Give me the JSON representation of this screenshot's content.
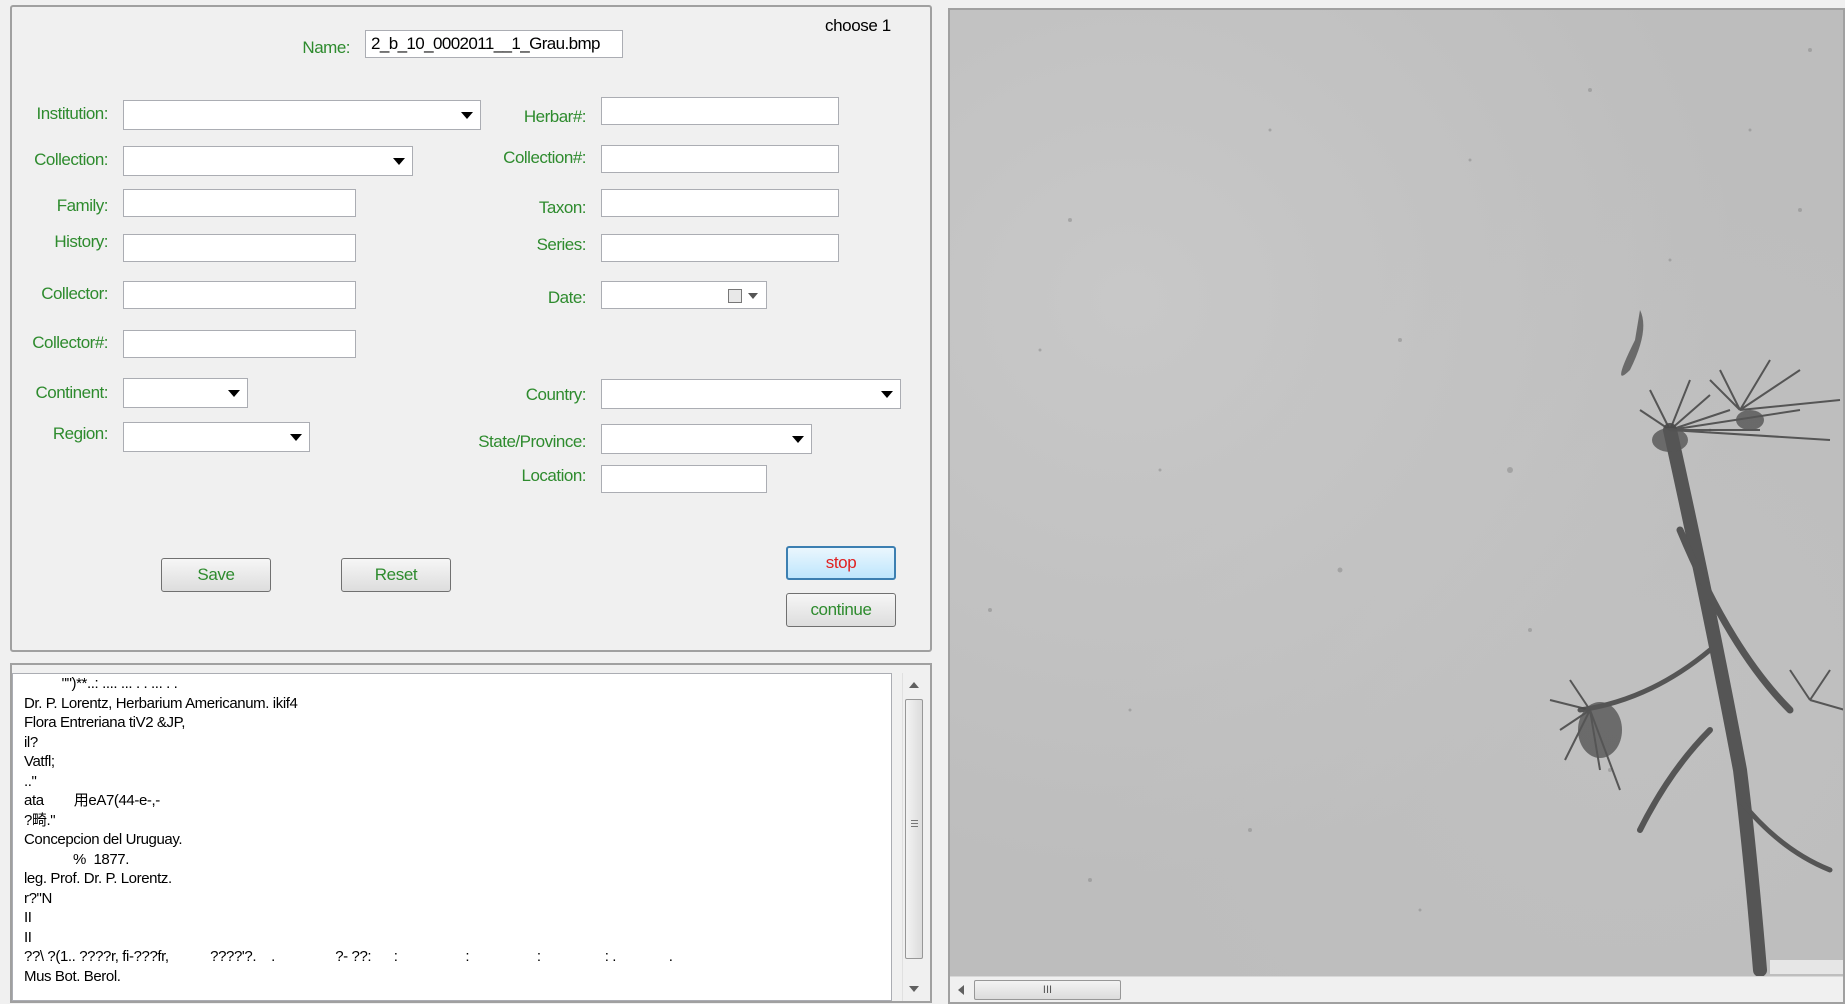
{
  "form": {
    "choose_label": "choose 1",
    "name_label": "Name:",
    "name_value": "2_b_10_0002011__1_Grau.bmp",
    "institution_label": "Institution:",
    "collection_label": "Collection:",
    "family_label": "Family:",
    "history_label": "History:",
    "collector_label": "Collector:",
    "collector_num_label": "Collector#:",
    "continent_label": "Continent:",
    "region_label": "Region:",
    "herbar_label": "Herbar#:",
    "collection_num_label": "Collection#:",
    "taxon_label": "Taxon:",
    "series_label": "Series:",
    "date_label": "Date:",
    "country_label": "Country:",
    "state_label": "State/Province:",
    "location_label": "Location:",
    "institution_value": "",
    "collection_value": "",
    "family_value": "",
    "history_value": "",
    "collector_value": "",
    "collector_num_value": "",
    "continent_value": "",
    "region_value": "",
    "herbar_value": "",
    "collection_num_value": "",
    "taxon_value": "",
    "series_value": "",
    "date_value": "",
    "country_value": "",
    "state_value": "",
    "location_value": ""
  },
  "buttons": {
    "save": "Save",
    "reset": "Reset",
    "stop": "stop",
    "continue": "continue"
  },
  "ocr": {
    "lines": [
      "          \"\")**..: .... ... . . ... . .",
      "Dr. P. Lorentz, Herbarium Americanum. ikif4",
      "Flora Entreriana tiV2 &JP,",
      "il?",
      "Vatfl;",
      "..\"",
      "ata        用eA7(44-e-,-",
      "?畸.\"",
      "Concepcion del Uruguay.",
      "             %  1877.",
      "leg. Prof. Dr. P. Lorentz.",
      "r?\"N",
      "II",
      "II",
      "??\\ ?(1.. ????r, fi-???fr,           ????'?.    .                ?- ??:      :                  :                  :                 : .              .",
      "Mus Bot. Berol."
    ]
  },
  "viewer": {
    "hscroll_grip": "III"
  },
  "colors": {
    "label_green": "#2e8b2e",
    "stop_red": "#e02020",
    "focus_blue": "#3c7fb1"
  }
}
